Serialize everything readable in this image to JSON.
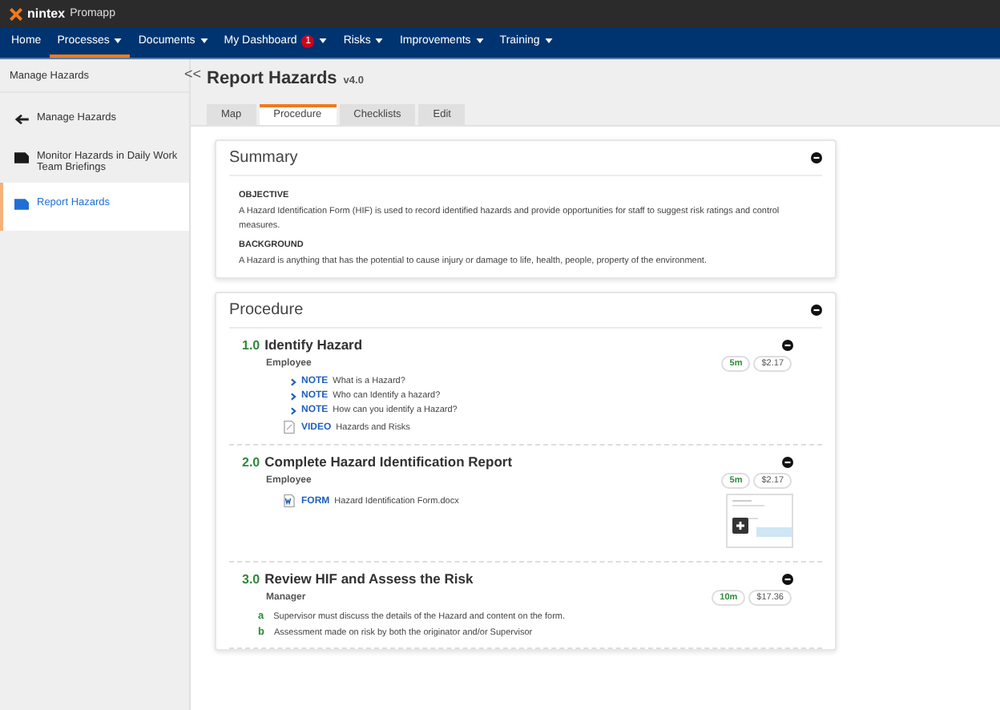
{
  "brand": {
    "name": "nintex",
    "product": "Promapp"
  },
  "nav": [
    {
      "label": "Home",
      "has_menu": false,
      "selected": false
    },
    {
      "label": "Processes",
      "has_menu": true,
      "selected": true
    },
    {
      "label": "Documents",
      "has_menu": true,
      "selected": false
    },
    {
      "label": "My Dashboard",
      "has_menu": true,
      "selected": false,
      "badge": "1"
    },
    {
      "label": "Risks",
      "has_menu": true,
      "selected": false
    },
    {
      "label": "Improvements",
      "has_menu": true,
      "selected": false
    },
    {
      "label": "Training",
      "has_menu": true,
      "selected": false
    }
  ],
  "sidebar": {
    "title": "Manage Hazards",
    "collapse": "<<",
    "items": [
      {
        "kind": "back",
        "label": "Manage Hazards",
        "selected": false
      },
      {
        "kind": "process",
        "label": "Monitor Hazards in Daily Work Team Briefings",
        "selected": false
      },
      {
        "kind": "process",
        "label": "Report Hazards",
        "selected": true
      }
    ]
  },
  "page": {
    "title": "Report Hazards",
    "version": "v4.0"
  },
  "tabs": [
    {
      "label": "Map",
      "selected": false
    },
    {
      "label": "Procedure",
      "selected": true
    },
    {
      "label": "Checklists",
      "selected": false
    },
    {
      "label": "Edit",
      "selected": false
    }
  ],
  "summary": {
    "title": "Summary",
    "sections": [
      {
        "heading": "OBJECTIVE",
        "text": "A Hazard Identification Form (HIF) is used to record identified hazards and provide opportunities for staff to suggest risk ratings and control measures."
      },
      {
        "heading": "BACKGROUND",
        "text": "A Hazard is anything that has the potential to cause injury or damage to life, health, people, property of the environment."
      }
    ]
  },
  "procedure": {
    "title": "Procedure",
    "steps": [
      {
        "number": "1.0",
        "title": "Identify Hazard",
        "role": "Employee",
        "time": "5m",
        "cost": "$2.17",
        "has_preview": false,
        "items": [
          {
            "kind": "note",
            "tag": "NOTE",
            "text": "What is a Hazard?"
          },
          {
            "kind": "note",
            "tag": "NOTE",
            "text": "Who can Identify a hazard?"
          },
          {
            "kind": "note",
            "tag": "NOTE",
            "text": "How can you identify a Hazard?"
          },
          {
            "kind": "video",
            "tag": "VIDEO",
            "text": "Hazards and Risks"
          }
        ]
      },
      {
        "number": "2.0",
        "title": "Complete Hazard Identification Report",
        "role": "Employee",
        "time": "5m",
        "cost": "$2.17",
        "has_preview": true,
        "items": [
          {
            "kind": "form",
            "tag": "FORM",
            "text": "Hazard Identification Form.docx"
          }
        ]
      },
      {
        "number": "3.0",
        "title": "Review HIF and Assess the Risk",
        "role": "Manager",
        "time": "10m",
        "cost": "$17.36",
        "has_preview": false,
        "items": [
          {
            "kind": "sub",
            "tag": "a",
            "text": "Supervisor must discuss the details of the Hazard and content on the form."
          },
          {
            "kind": "sub",
            "tag": "b",
            "text": "Assessment made on risk by both the originator and/or Supervisor"
          }
        ]
      }
    ]
  }
}
